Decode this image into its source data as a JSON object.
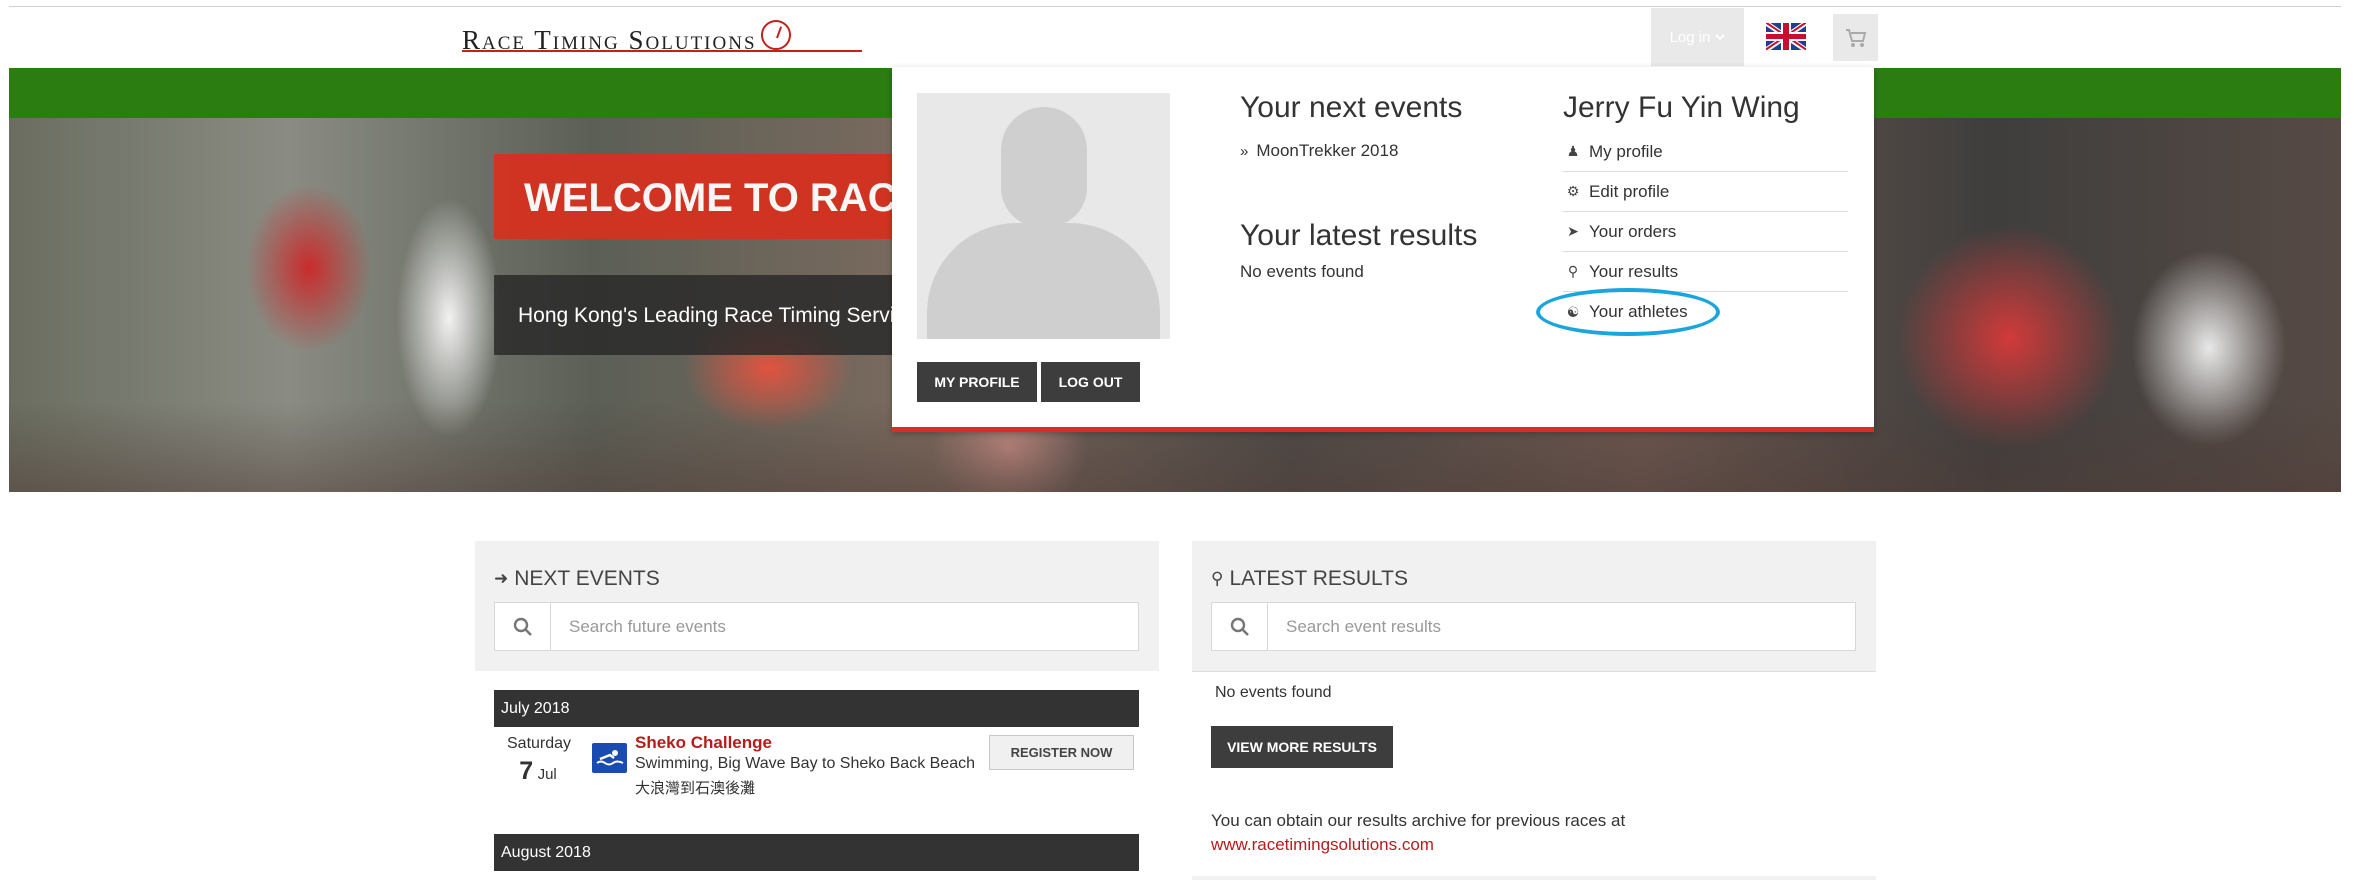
{
  "header": {
    "logo_text": "Race Timing Solutions",
    "login_label": "Log in",
    "language_icon": "uk-flag-icon",
    "cart_icon": "cart-icon",
    "brand_red": "#c0231c",
    "brand_green": "#2b7d12"
  },
  "hero": {
    "title": "WELCOME TO RACE TIMING SOLUTIONS",
    "subtitle": "Hong Kong's Leading Race Timing Services"
  },
  "user_dropdown": {
    "my_profile_button": "MY PROFILE",
    "logout_button": "LOG OUT",
    "next_events_title": "Your next events",
    "next_events": [
      "MoonTrekker 2018"
    ],
    "latest_results_title": "Your latest results",
    "latest_results_empty": "No events found",
    "user_name": "Jerry Fu Yin Wing",
    "menu": [
      {
        "label": "My profile",
        "icon": "user-icon"
      },
      {
        "label": "Edit profile",
        "icon": "cogs-icon"
      },
      {
        "label": "Your orders",
        "icon": "tag-icon"
      },
      {
        "label": "Your results",
        "icon": "trophy-icon"
      },
      {
        "label": "Your athletes",
        "icon": "users-icon"
      }
    ],
    "highlight_color": "#1aa6dc"
  },
  "next_events_panel": {
    "heading": "NEXT EVENTS",
    "search_placeholder": "Search future events",
    "months": [
      {
        "label": "July 2018",
        "events": [
          {
            "weekday": "Saturday",
            "day": "7",
            "month": "Jul",
            "name": "Sheko Challenge",
            "description": "Swimming, Big Wave Bay to Sheko Back Beach",
            "description_cn": "大浪灣到石澳後灘",
            "button": "REGISTER NOW"
          }
        ]
      },
      {
        "label": "August 2018",
        "events": []
      }
    ]
  },
  "latest_results_panel": {
    "heading": "LATEST RESULTS",
    "search_placeholder": "Search event results",
    "empty_text": "No events found",
    "view_more_button": "VIEW MORE RESULTS",
    "archive_text": "You can obtain our results archive for previous races at",
    "archive_link": "www.racetimingsolutions.com"
  }
}
